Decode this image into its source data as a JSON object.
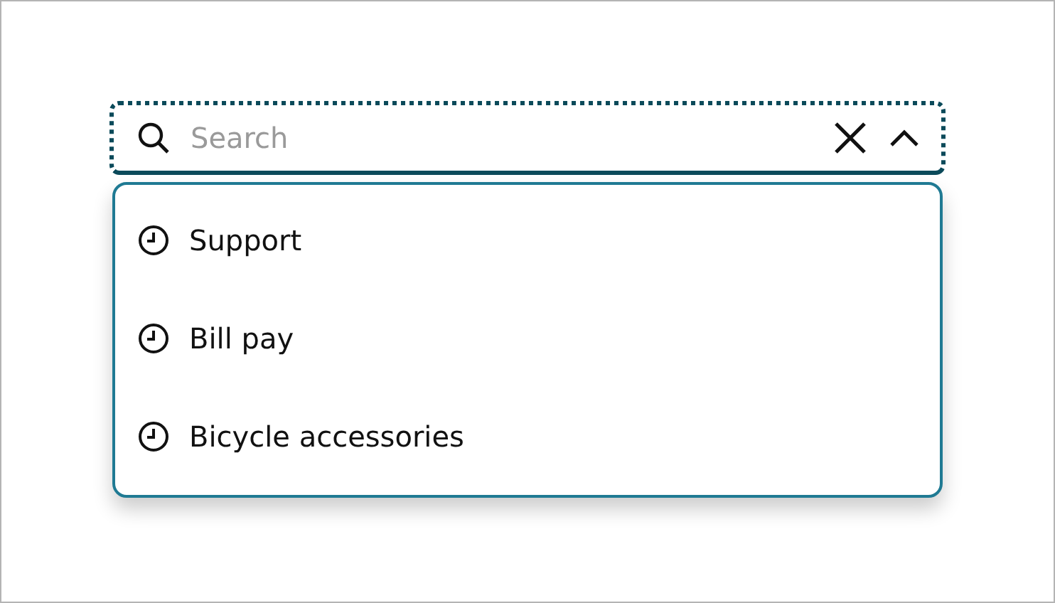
{
  "search": {
    "placeholder": "Search",
    "expanded": true
  },
  "suggestions": [
    {
      "label": "Support"
    },
    {
      "label": "Bill pay"
    },
    {
      "label": "Bicycle accessories"
    }
  ]
}
